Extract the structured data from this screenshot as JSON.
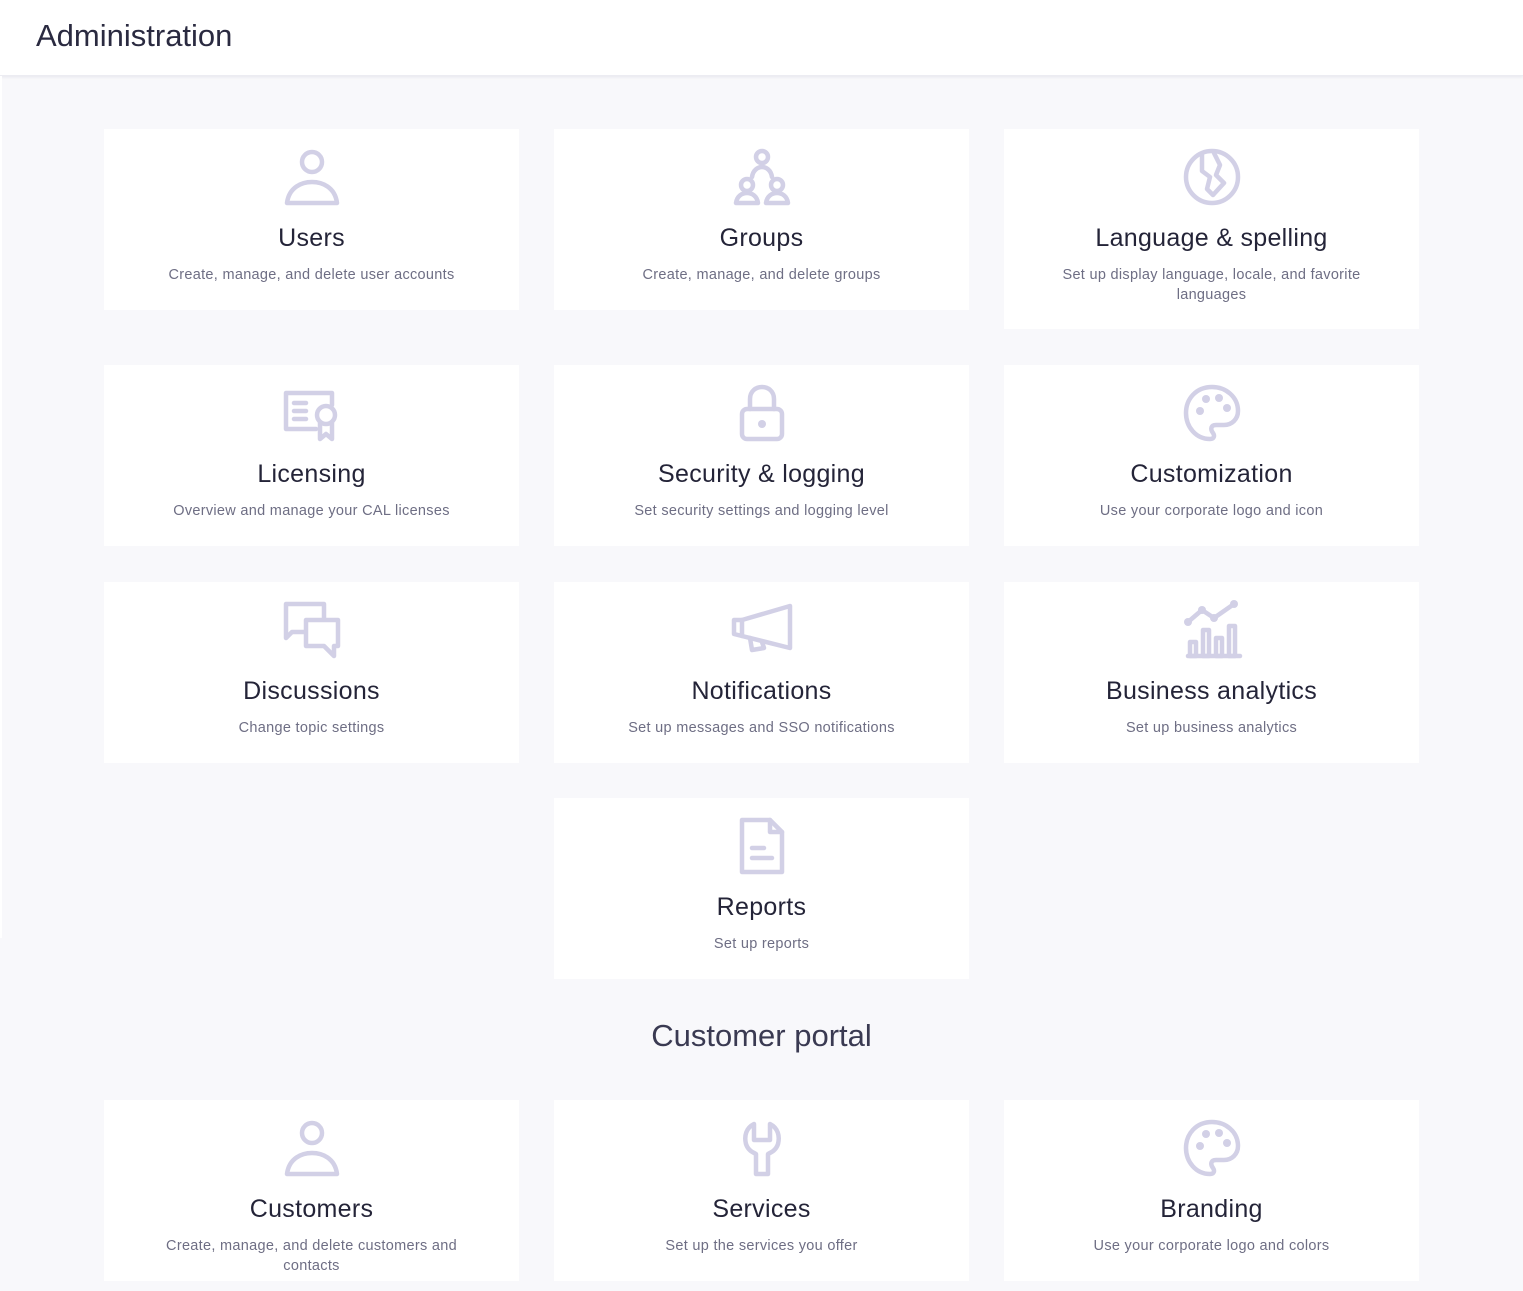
{
  "header": {
    "title": "Administration"
  },
  "admin_cards": [
    {
      "title": "Users",
      "description": "Create, manage, and delete user accounts",
      "icon": "user-icon"
    },
    {
      "title": "Groups",
      "description": "Create, manage, and delete groups",
      "icon": "groups-icon"
    },
    {
      "title": "Language & spelling",
      "description": "Set up display language, locale, and favorite languages",
      "icon": "globe-icon"
    },
    {
      "title": "Licensing",
      "description": "Overview and manage your CAL licenses",
      "icon": "certificate-icon"
    },
    {
      "title": "Security & logging",
      "description": "Set security settings and logging level",
      "icon": "lock-icon"
    },
    {
      "title": "Customization",
      "description": "Use your corporate logo and icon",
      "icon": "palette-icon"
    },
    {
      "title": "Discussions",
      "description": "Change topic settings",
      "icon": "chat-bubbles-icon"
    },
    {
      "title": "Notifications",
      "description": "Set up messages and SSO notifications",
      "icon": "megaphone-icon"
    },
    {
      "title": "Business analytics",
      "description": "Set up business analytics",
      "icon": "analytics-chart-icon"
    },
    {
      "title": "Reports",
      "description": "Set up reports",
      "icon": "document-icon"
    }
  ],
  "customer_portal": {
    "title": "Customer portal",
    "cards": [
      {
        "title": "Customers",
        "description": "Create, manage, and delete customers and contacts",
        "icon": "user-icon"
      },
      {
        "title": "Services",
        "description": "Set up the services you offer",
        "icon": "wrench-icon"
      },
      {
        "title": "Branding",
        "description": "Use your corporate logo and colors",
        "icon": "palette-icon"
      }
    ]
  },
  "colors": {
    "background": "#f8f8fb",
    "card": "#ffffff",
    "icon": "#d2d0e6",
    "title": "#242438",
    "description": "#6e6e84"
  }
}
